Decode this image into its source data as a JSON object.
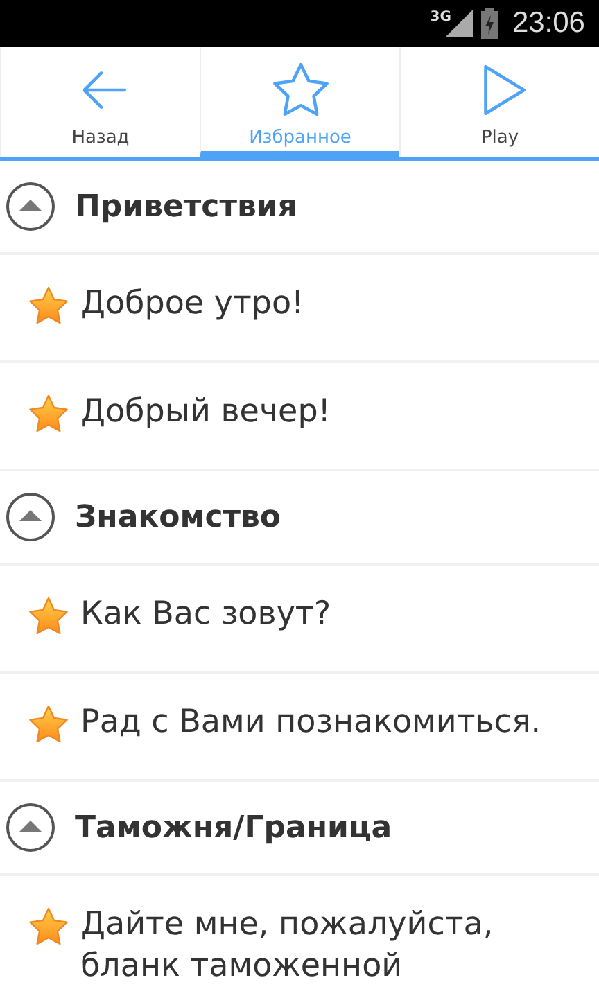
{
  "status_bar": {
    "network": "3G",
    "time": "23:06"
  },
  "tabs": [
    {
      "label": "Назад",
      "kind": "back",
      "selected": false
    },
    {
      "label": "Избранное",
      "kind": "favorites",
      "selected": true
    },
    {
      "label": "Play",
      "kind": "play",
      "selected": false
    }
  ],
  "sections": [
    {
      "title": "Приветствия",
      "expanded": true,
      "items": [
        {
          "text": "Доброе утро!",
          "favorite": true
        },
        {
          "text": "Добрый вечер!",
          "favorite": true
        }
      ]
    },
    {
      "title": "Знакомство",
      "expanded": true,
      "items": [
        {
          "text": "Как Вас зовут?",
          "favorite": true
        },
        {
          "text": "Рад с Вами познакомиться.",
          "favorite": true
        }
      ]
    },
    {
      "title": "Таможня/Граница",
      "expanded": true,
      "items": [
        {
          "text": "Дайте мне, пожалуйста, бланк таможенной",
          "favorite": true
        }
      ]
    }
  ]
}
